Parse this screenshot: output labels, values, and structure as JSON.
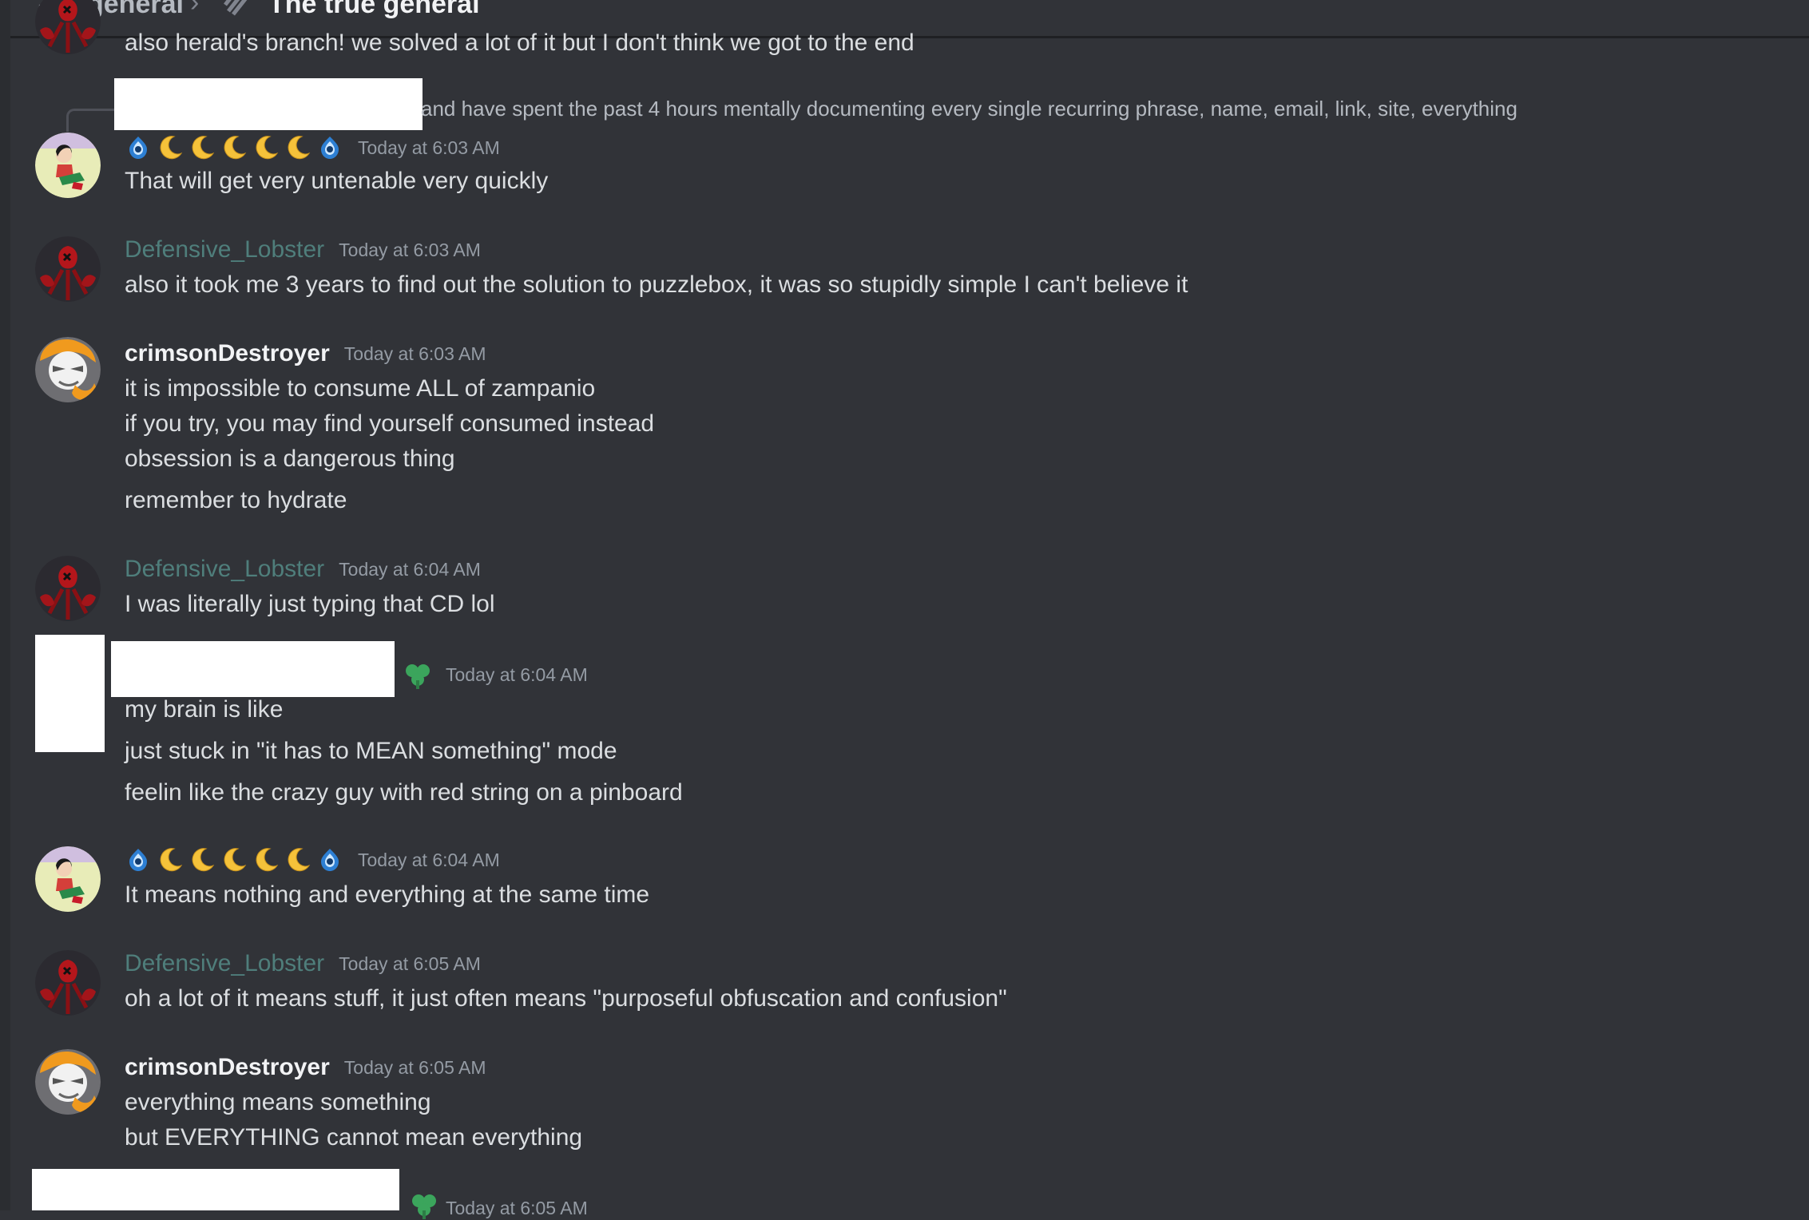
{
  "header": {
    "channel": "general",
    "thread": "The true general"
  },
  "reply": {
    "text": "and have spent the past 4 hours mentally documenting every single recurring phrase, name, email, link, site, everything"
  },
  "messages": [
    {
      "author": "",
      "time": "",
      "lines": [
        "also herald's branch! we solved a lot of it but I don't think we got to the end"
      ]
    },
    {
      "author": "",
      "time": "Today at 6:03 AM",
      "lines": [
        "That will get very untenable very quickly"
      ]
    },
    {
      "author": "Defensive_Lobster",
      "time": "Today at 6:03 AM",
      "lines": [
        "also it took me 3 years to find out the solution to puzzlebox, it was so stupidly simple I can't believe it"
      ]
    },
    {
      "author": "crimsonDestroyer",
      "time": "Today at 6:03 AM",
      "lines": [
        "it is impossible to consume ALL of zampanio",
        "if you try, you may find yourself consumed instead",
        "obsession is a dangerous thing",
        "remember to hydrate"
      ]
    },
    {
      "author": "Defensive_Lobster",
      "time": "Today at 6:04 AM",
      "lines": [
        "I was literally just typing that CD lol"
      ]
    },
    {
      "author": "",
      "time": "Today at 6:04 AM",
      "lines": [
        "my brain is like",
        "just stuck in \"it has to MEAN something\" mode",
        "feelin like the crazy guy with red string on a pinboard"
      ]
    },
    {
      "author": "",
      "time": "Today at 6:04 AM",
      "lines": [
        "It means nothing and everything at the same time"
      ]
    },
    {
      "author": "Defensive_Lobster",
      "time": "Today at 6:05 AM",
      "lines": [
        "oh a lot of it means stuff, it just often means \"purposeful obfuscation and confusion\""
      ]
    },
    {
      "author": "crimsonDestroyer",
      "time": "Today at 6:05 AM",
      "lines": [
        "everything means something",
        "but EVERYTHING cannot mean everything"
      ]
    },
    {
      "author": "",
      "time": "Today at 6:05 AM",
      "lines": []
    }
  ],
  "icons": {
    "moon": "crescent-moon-emoji",
    "eye": "blue-eye-emoji",
    "clover": "green-clover-badge"
  },
  "colors": {
    "background": "#313338",
    "username_teal": "#4f7e7b",
    "timestamp": "#949ba4",
    "text": "#dbdee1"
  }
}
